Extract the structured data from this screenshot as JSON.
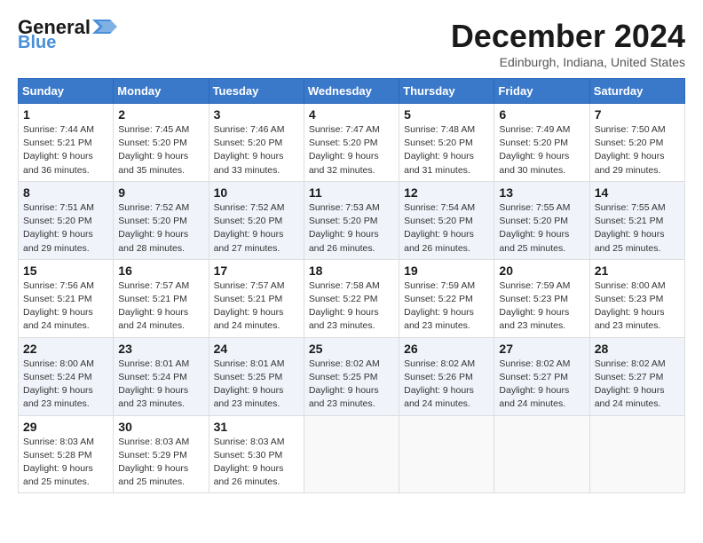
{
  "header": {
    "logo_general": "General",
    "logo_blue": "Blue",
    "month": "December 2024",
    "location": "Edinburgh, Indiana, United States"
  },
  "weekdays": [
    "Sunday",
    "Monday",
    "Tuesday",
    "Wednesday",
    "Thursday",
    "Friday",
    "Saturday"
  ],
  "weeks": [
    [
      {
        "day": "1",
        "sunrise": "Sunrise: 7:44 AM",
        "sunset": "Sunset: 5:21 PM",
        "daylight": "Daylight: 9 hours and 36 minutes."
      },
      {
        "day": "2",
        "sunrise": "Sunrise: 7:45 AM",
        "sunset": "Sunset: 5:20 PM",
        "daylight": "Daylight: 9 hours and 35 minutes."
      },
      {
        "day": "3",
        "sunrise": "Sunrise: 7:46 AM",
        "sunset": "Sunset: 5:20 PM",
        "daylight": "Daylight: 9 hours and 33 minutes."
      },
      {
        "day": "4",
        "sunrise": "Sunrise: 7:47 AM",
        "sunset": "Sunset: 5:20 PM",
        "daylight": "Daylight: 9 hours and 32 minutes."
      },
      {
        "day": "5",
        "sunrise": "Sunrise: 7:48 AM",
        "sunset": "Sunset: 5:20 PM",
        "daylight": "Daylight: 9 hours and 31 minutes."
      },
      {
        "day": "6",
        "sunrise": "Sunrise: 7:49 AM",
        "sunset": "Sunset: 5:20 PM",
        "daylight": "Daylight: 9 hours and 30 minutes."
      },
      {
        "day": "7",
        "sunrise": "Sunrise: 7:50 AM",
        "sunset": "Sunset: 5:20 PM",
        "daylight": "Daylight: 9 hours and 29 minutes."
      }
    ],
    [
      {
        "day": "8",
        "sunrise": "Sunrise: 7:51 AM",
        "sunset": "Sunset: 5:20 PM",
        "daylight": "Daylight: 9 hours and 29 minutes."
      },
      {
        "day": "9",
        "sunrise": "Sunrise: 7:52 AM",
        "sunset": "Sunset: 5:20 PM",
        "daylight": "Daylight: 9 hours and 28 minutes."
      },
      {
        "day": "10",
        "sunrise": "Sunrise: 7:52 AM",
        "sunset": "Sunset: 5:20 PM",
        "daylight": "Daylight: 9 hours and 27 minutes."
      },
      {
        "day": "11",
        "sunrise": "Sunrise: 7:53 AM",
        "sunset": "Sunset: 5:20 PM",
        "daylight": "Daylight: 9 hours and 26 minutes."
      },
      {
        "day": "12",
        "sunrise": "Sunrise: 7:54 AM",
        "sunset": "Sunset: 5:20 PM",
        "daylight": "Daylight: 9 hours and 26 minutes."
      },
      {
        "day": "13",
        "sunrise": "Sunrise: 7:55 AM",
        "sunset": "Sunset: 5:20 PM",
        "daylight": "Daylight: 9 hours and 25 minutes."
      },
      {
        "day": "14",
        "sunrise": "Sunrise: 7:55 AM",
        "sunset": "Sunset: 5:21 PM",
        "daylight": "Daylight: 9 hours and 25 minutes."
      }
    ],
    [
      {
        "day": "15",
        "sunrise": "Sunrise: 7:56 AM",
        "sunset": "Sunset: 5:21 PM",
        "daylight": "Daylight: 9 hours and 24 minutes."
      },
      {
        "day": "16",
        "sunrise": "Sunrise: 7:57 AM",
        "sunset": "Sunset: 5:21 PM",
        "daylight": "Daylight: 9 hours and 24 minutes."
      },
      {
        "day": "17",
        "sunrise": "Sunrise: 7:57 AM",
        "sunset": "Sunset: 5:21 PM",
        "daylight": "Daylight: 9 hours and 24 minutes."
      },
      {
        "day": "18",
        "sunrise": "Sunrise: 7:58 AM",
        "sunset": "Sunset: 5:22 PM",
        "daylight": "Daylight: 9 hours and 23 minutes."
      },
      {
        "day": "19",
        "sunrise": "Sunrise: 7:59 AM",
        "sunset": "Sunset: 5:22 PM",
        "daylight": "Daylight: 9 hours and 23 minutes."
      },
      {
        "day": "20",
        "sunrise": "Sunrise: 7:59 AM",
        "sunset": "Sunset: 5:23 PM",
        "daylight": "Daylight: 9 hours and 23 minutes."
      },
      {
        "day": "21",
        "sunrise": "Sunrise: 8:00 AM",
        "sunset": "Sunset: 5:23 PM",
        "daylight": "Daylight: 9 hours and 23 minutes."
      }
    ],
    [
      {
        "day": "22",
        "sunrise": "Sunrise: 8:00 AM",
        "sunset": "Sunset: 5:24 PM",
        "daylight": "Daylight: 9 hours and 23 minutes."
      },
      {
        "day": "23",
        "sunrise": "Sunrise: 8:01 AM",
        "sunset": "Sunset: 5:24 PM",
        "daylight": "Daylight: 9 hours and 23 minutes."
      },
      {
        "day": "24",
        "sunrise": "Sunrise: 8:01 AM",
        "sunset": "Sunset: 5:25 PM",
        "daylight": "Daylight: 9 hours and 23 minutes."
      },
      {
        "day": "25",
        "sunrise": "Sunrise: 8:02 AM",
        "sunset": "Sunset: 5:25 PM",
        "daylight": "Daylight: 9 hours and 23 minutes."
      },
      {
        "day": "26",
        "sunrise": "Sunrise: 8:02 AM",
        "sunset": "Sunset: 5:26 PM",
        "daylight": "Daylight: 9 hours and 24 minutes."
      },
      {
        "day": "27",
        "sunrise": "Sunrise: 8:02 AM",
        "sunset": "Sunset: 5:27 PM",
        "daylight": "Daylight: 9 hours and 24 minutes."
      },
      {
        "day": "28",
        "sunrise": "Sunrise: 8:02 AM",
        "sunset": "Sunset: 5:27 PM",
        "daylight": "Daylight: 9 hours and 24 minutes."
      }
    ],
    [
      {
        "day": "29",
        "sunrise": "Sunrise: 8:03 AM",
        "sunset": "Sunset: 5:28 PM",
        "daylight": "Daylight: 9 hours and 25 minutes."
      },
      {
        "day": "30",
        "sunrise": "Sunrise: 8:03 AM",
        "sunset": "Sunset: 5:29 PM",
        "daylight": "Daylight: 9 hours and 25 minutes."
      },
      {
        "day": "31",
        "sunrise": "Sunrise: 8:03 AM",
        "sunset": "Sunset: 5:30 PM",
        "daylight": "Daylight: 9 hours and 26 minutes."
      },
      null,
      null,
      null,
      null
    ]
  ]
}
